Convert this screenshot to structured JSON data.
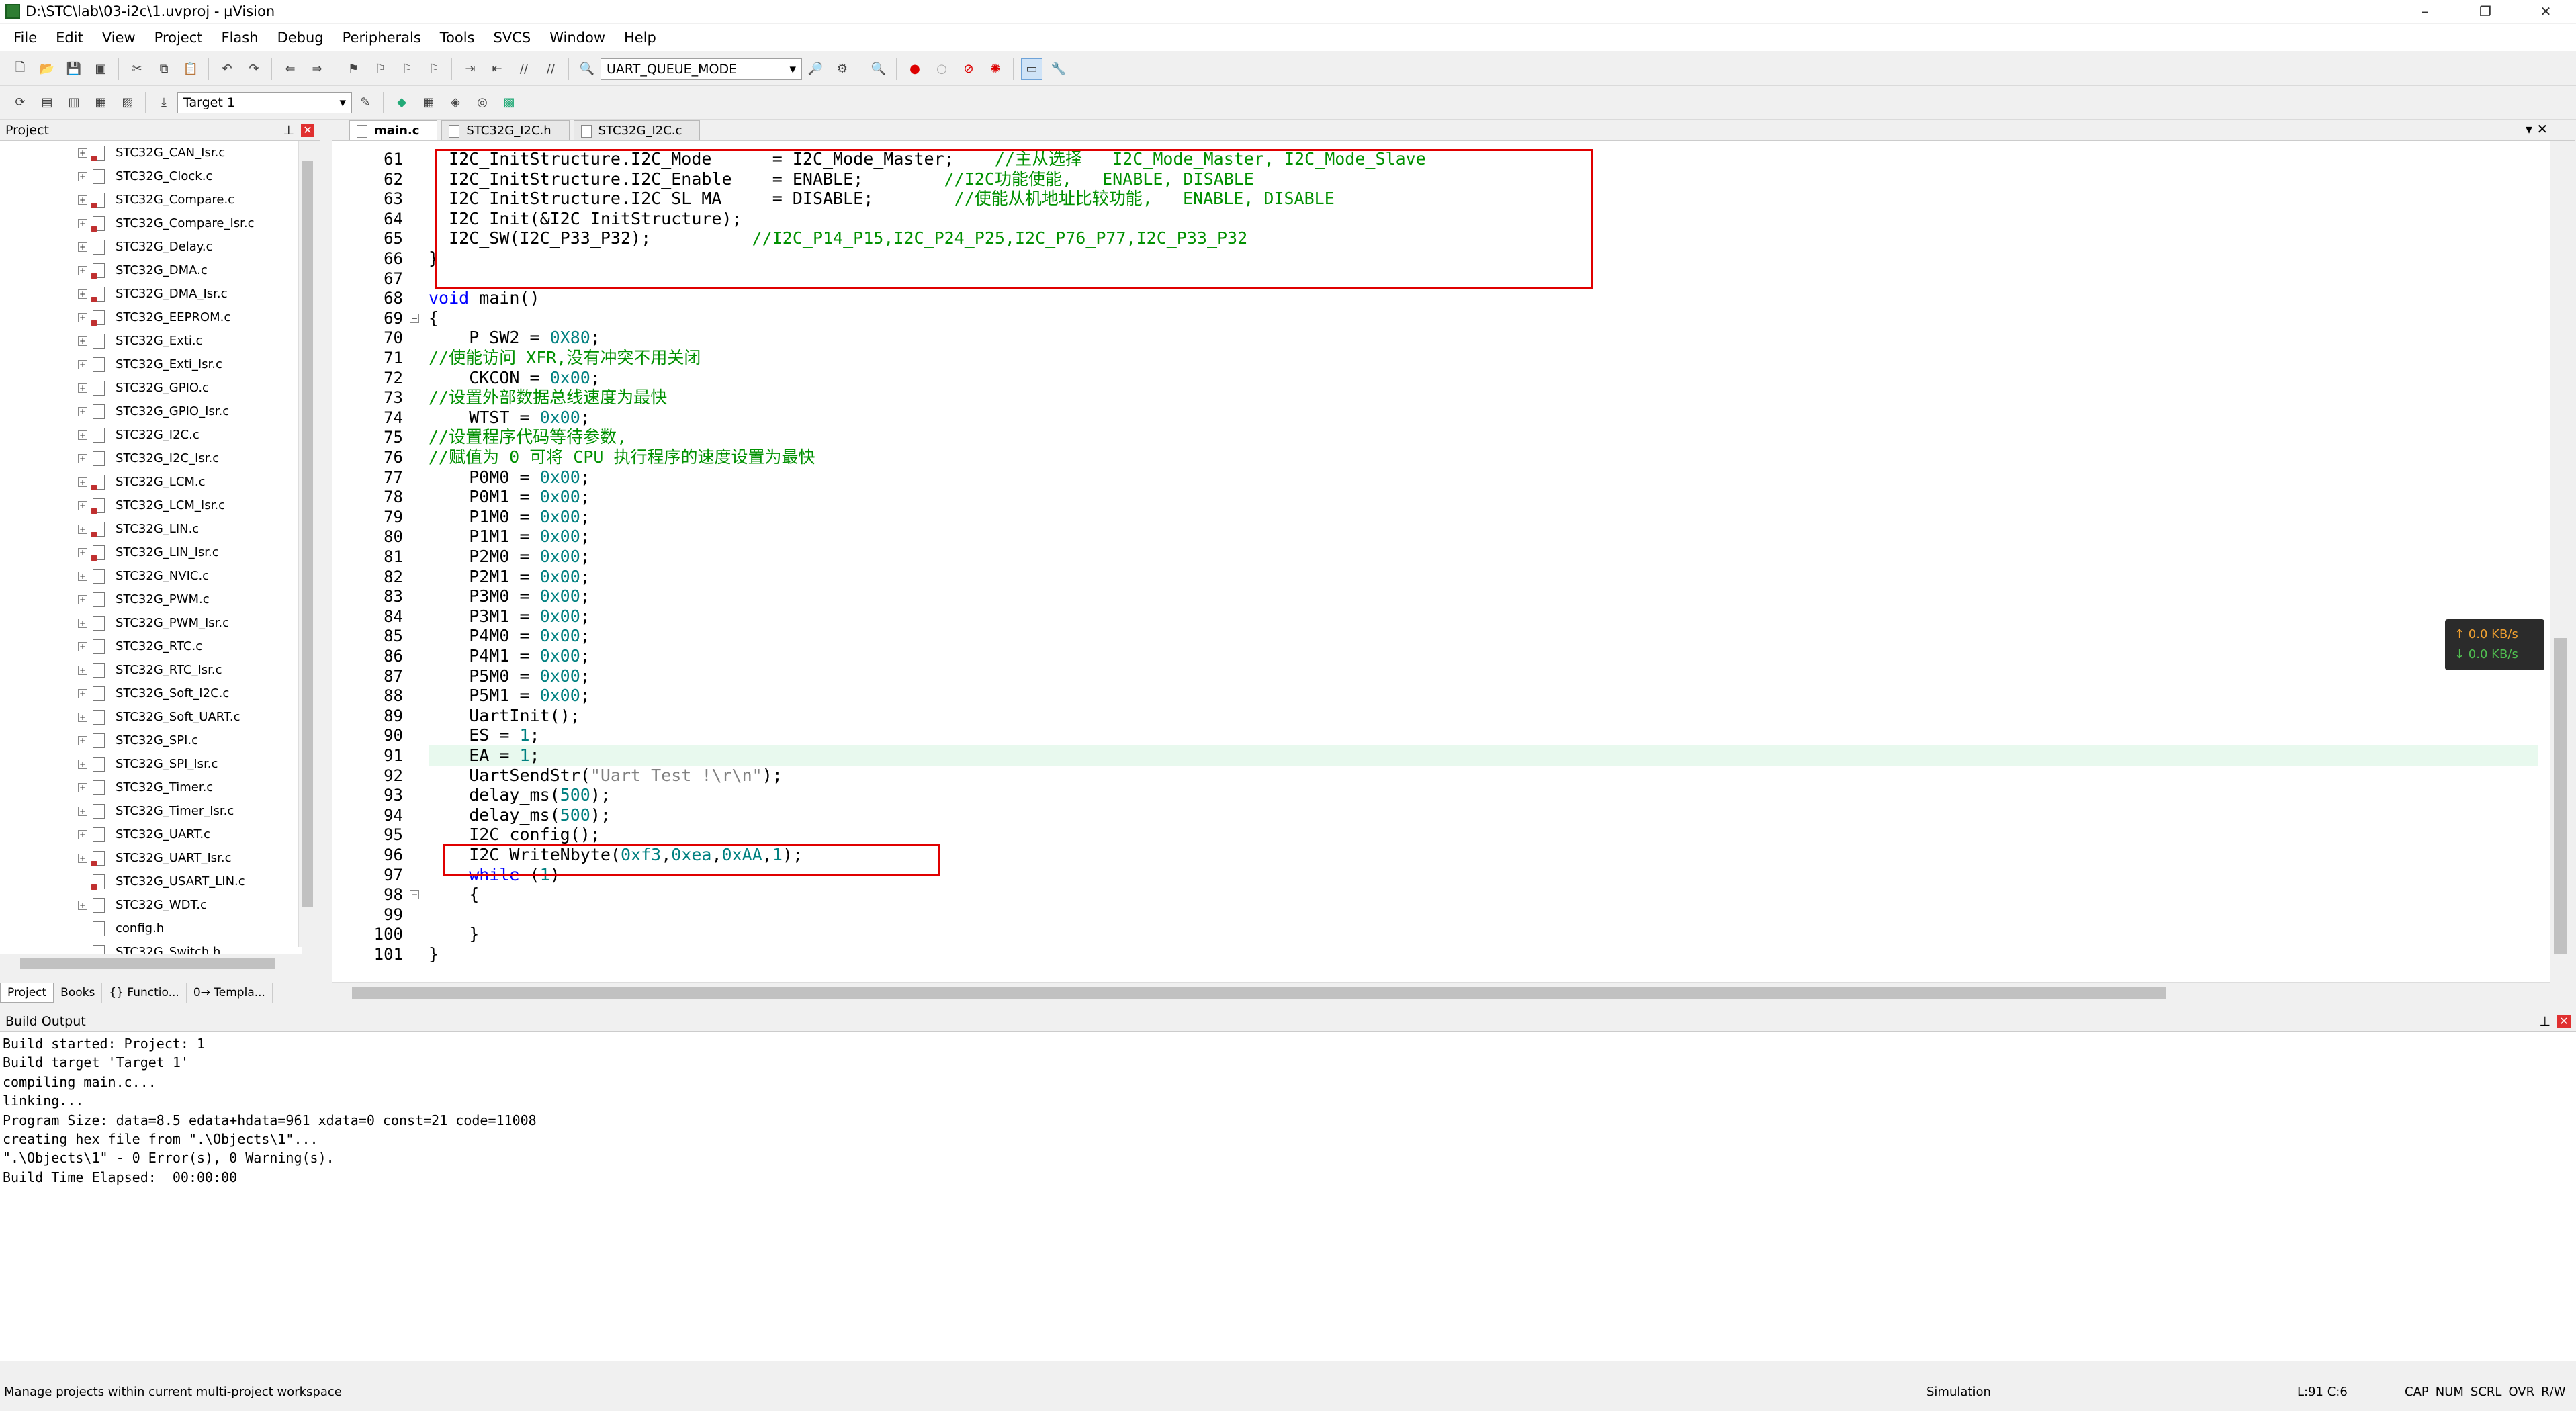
{
  "window": {
    "title": "D:\\STC\\lab\\03-i2c\\1.uvproj - µVision",
    "min": "–",
    "max": "❐",
    "close": "✕"
  },
  "menu": [
    "File",
    "Edit",
    "View",
    "Project",
    "Flash",
    "Debug",
    "Peripherals",
    "Tools",
    "SVCS",
    "Window",
    "Help"
  ],
  "toolbar": {
    "target_combo": "UART_QUEUE_MODE",
    "target_select": "Target 1"
  },
  "project_panel": {
    "title": "Project",
    "files": [
      {
        "name": "STC32G_CAN_Isr.c",
        "lock": true,
        "plus": true
      },
      {
        "name": "STC32G_Clock.c",
        "lock": false,
        "plus": true
      },
      {
        "name": "STC32G_Compare.c",
        "lock": true,
        "plus": true
      },
      {
        "name": "STC32G_Compare_Isr.c",
        "lock": true,
        "plus": true
      },
      {
        "name": "STC32G_Delay.c",
        "lock": false,
        "plus": true
      },
      {
        "name": "STC32G_DMA.c",
        "lock": true,
        "plus": true
      },
      {
        "name": "STC32G_DMA_Isr.c",
        "lock": true,
        "plus": true
      },
      {
        "name": "STC32G_EEPROM.c",
        "lock": true,
        "plus": true
      },
      {
        "name": "STC32G_Exti.c",
        "lock": false,
        "plus": true
      },
      {
        "name": "STC32G_Exti_Isr.c",
        "lock": false,
        "plus": true
      },
      {
        "name": "STC32G_GPIO.c",
        "lock": false,
        "plus": true
      },
      {
        "name": "STC32G_GPIO_Isr.c",
        "lock": false,
        "plus": true
      },
      {
        "name": "STC32G_I2C.c",
        "lock": false,
        "plus": true
      },
      {
        "name": "STC32G_I2C_Isr.c",
        "lock": false,
        "plus": true
      },
      {
        "name": "STC32G_LCM.c",
        "lock": true,
        "plus": true
      },
      {
        "name": "STC32G_LCM_Isr.c",
        "lock": true,
        "plus": true
      },
      {
        "name": "STC32G_LIN.c",
        "lock": true,
        "plus": true
      },
      {
        "name": "STC32G_LIN_Isr.c",
        "lock": true,
        "plus": true
      },
      {
        "name": "STC32G_NVIC.c",
        "lock": false,
        "plus": true
      },
      {
        "name": "STC32G_PWM.c",
        "lock": false,
        "plus": true
      },
      {
        "name": "STC32G_PWM_Isr.c",
        "lock": false,
        "plus": true
      },
      {
        "name": "STC32G_RTC.c",
        "lock": false,
        "plus": true
      },
      {
        "name": "STC32G_RTC_Isr.c",
        "lock": false,
        "plus": true
      },
      {
        "name": "STC32G_Soft_I2C.c",
        "lock": false,
        "plus": true
      },
      {
        "name": "STC32G_Soft_UART.c",
        "lock": false,
        "plus": true
      },
      {
        "name": "STC32G_SPI.c",
        "lock": false,
        "plus": true
      },
      {
        "name": "STC32G_SPI_Isr.c",
        "lock": false,
        "plus": true
      },
      {
        "name": "STC32G_Timer.c",
        "lock": false,
        "plus": true
      },
      {
        "name": "STC32G_Timer_Isr.c",
        "lock": false,
        "plus": true
      },
      {
        "name": "STC32G_UART.c",
        "lock": false,
        "plus": true
      },
      {
        "name": "STC32G_UART_Isr.c",
        "lock": true,
        "plus": true
      },
      {
        "name": "STC32G_USART_LIN.c",
        "lock": true,
        "plus": false
      },
      {
        "name": "STC32G_WDT.c",
        "lock": false,
        "plus": true
      },
      {
        "name": "config.h",
        "lock": false,
        "plus": false
      },
      {
        "name": "STC32G_Switch.h",
        "lock": false,
        "plus": false
      }
    ],
    "bottom_tabs": [
      "Project",
      "Books",
      "{} Functio...",
      "0→ Templa..."
    ]
  },
  "editor": {
    "tabs": [
      "main.c",
      "STC32G_I2C.h",
      "STC32G_I2C.c"
    ],
    "lines": [
      {
        "n": "61",
        "segs": [
          [
            "",
            "  I2C_InitStructure.I2C_Mode      = I2C_Mode_Master;    "
          ],
          [
            "cm",
            "//主从选择   I2C_Mode_Master, I2C_Mode_Slave"
          ]
        ]
      },
      {
        "n": "62",
        "segs": [
          [
            "",
            "  I2C_InitStructure.I2C_Enable    = ENABLE;        "
          ],
          [
            "cm",
            "//I2C功能使能,   ENABLE, DISABLE"
          ]
        ]
      },
      {
        "n": "63",
        "segs": [
          [
            "",
            "  I2C_InitStructure.I2C_SL_MA     = DISABLE;        "
          ],
          [
            "cm",
            "//使能从机地址比较功能,   ENABLE, DISABLE"
          ]
        ]
      },
      {
        "n": "64",
        "segs": [
          [
            "",
            "  I2C_Init(&I2C_InitStructure);"
          ]
        ]
      },
      {
        "n": "65",
        "segs": [
          [
            "",
            "  I2C_SW(I2C_P33_P32);          "
          ],
          [
            "cm",
            "//I2C_P14_P15,I2C_P24_P25,I2C_P76_P77,I2C_P33_P32"
          ]
        ]
      },
      {
        "n": "66",
        "segs": [
          [
            "",
            "}"
          ]
        ]
      },
      {
        "n": "67",
        "segs": []
      },
      {
        "n": "68",
        "segs": [
          [
            "kw",
            "void"
          ],
          [
            "",
            " main()"
          ]
        ]
      },
      {
        "n": "69",
        "segs": [
          [
            "",
            "{"
          ]
        ]
      },
      {
        "n": "70",
        "segs": [
          [
            "",
            "    P_SW2 = "
          ],
          [
            "num",
            "0X80"
          ],
          [
            "",
            ";"
          ]
        ]
      },
      {
        "n": "71",
        "segs": [
          [
            "cm",
            "//使能访问 XFR,没有冲突不用关闭"
          ]
        ]
      },
      {
        "n": "72",
        "segs": [
          [
            "",
            "    CKCON = "
          ],
          [
            "num",
            "0x00"
          ],
          [
            "",
            ";"
          ]
        ]
      },
      {
        "n": "73",
        "segs": [
          [
            "cm",
            "//设置外部数据总线速度为最快"
          ]
        ]
      },
      {
        "n": "74",
        "segs": [
          [
            "",
            "    WTST = "
          ],
          [
            "num",
            "0x00"
          ],
          [
            "",
            ";"
          ]
        ]
      },
      {
        "n": "75",
        "segs": [
          [
            "cm",
            "//设置程序代码等待参数,"
          ]
        ]
      },
      {
        "n": "76",
        "segs": [
          [
            "cm",
            "//赋值为 0 可将 CPU 执行程序的速度设置为最快"
          ]
        ]
      },
      {
        "n": "77",
        "segs": [
          [
            "",
            "    P0M0 = "
          ],
          [
            "num",
            "0x00"
          ],
          [
            "",
            ";"
          ]
        ]
      },
      {
        "n": "78",
        "segs": [
          [
            "",
            "    P0M1 = "
          ],
          [
            "num",
            "0x00"
          ],
          [
            "",
            ";"
          ]
        ]
      },
      {
        "n": "79",
        "segs": [
          [
            "",
            "    P1M0 = "
          ],
          [
            "num",
            "0x00"
          ],
          [
            "",
            ";"
          ]
        ]
      },
      {
        "n": "80",
        "segs": [
          [
            "",
            "    P1M1 = "
          ],
          [
            "num",
            "0x00"
          ],
          [
            "",
            ";"
          ]
        ]
      },
      {
        "n": "81",
        "segs": [
          [
            "",
            "    P2M0 = "
          ],
          [
            "num",
            "0x00"
          ],
          [
            "",
            ";"
          ]
        ]
      },
      {
        "n": "82",
        "segs": [
          [
            "",
            "    P2M1 = "
          ],
          [
            "num",
            "0x00"
          ],
          [
            "",
            ";"
          ]
        ]
      },
      {
        "n": "83",
        "segs": [
          [
            "",
            "    P3M0 = "
          ],
          [
            "num",
            "0x00"
          ],
          [
            "",
            ";"
          ]
        ]
      },
      {
        "n": "84",
        "segs": [
          [
            "",
            "    P3M1 = "
          ],
          [
            "num",
            "0x00"
          ],
          [
            "",
            ";"
          ]
        ]
      },
      {
        "n": "85",
        "segs": [
          [
            "",
            "    P4M0 = "
          ],
          [
            "num",
            "0x00"
          ],
          [
            "",
            ";"
          ]
        ]
      },
      {
        "n": "86",
        "segs": [
          [
            "",
            "    P4M1 = "
          ],
          [
            "num",
            "0x00"
          ],
          [
            "",
            ";"
          ]
        ]
      },
      {
        "n": "87",
        "segs": [
          [
            "",
            "    P5M0 = "
          ],
          [
            "num",
            "0x00"
          ],
          [
            "",
            ";"
          ]
        ]
      },
      {
        "n": "88",
        "segs": [
          [
            "",
            "    P5M1 = "
          ],
          [
            "num",
            "0x00"
          ],
          [
            "",
            ";"
          ]
        ]
      },
      {
        "n": "89",
        "segs": [
          [
            "",
            "    UartInit();"
          ]
        ]
      },
      {
        "n": "90",
        "segs": [
          [
            "",
            "    ES = "
          ],
          [
            "num",
            "1"
          ],
          [
            "",
            ";"
          ]
        ]
      },
      {
        "n": "91",
        "segs": [
          [
            "",
            "    EA = "
          ],
          [
            "num",
            "1"
          ],
          [
            "",
            ";"
          ]
        ]
      },
      {
        "n": "92",
        "segs": [
          [
            "",
            "    UartSendStr("
          ],
          [
            "str",
            "\"Uart Test !\\r\\n\""
          ],
          [
            "",
            ");"
          ]
        ]
      },
      {
        "n": "93",
        "segs": [
          [
            "",
            "    delay_ms("
          ],
          [
            "num",
            "500"
          ],
          [
            "",
            ");"
          ]
        ]
      },
      {
        "n": "94",
        "segs": [
          [
            "",
            "    delay_ms("
          ],
          [
            "num",
            "500"
          ],
          [
            "",
            ");"
          ]
        ]
      },
      {
        "n": "95",
        "segs": [
          [
            "",
            "    I2C_config();"
          ]
        ]
      },
      {
        "n": "96",
        "segs": [
          [
            "",
            "    I2C_WriteNbyte("
          ],
          [
            "num",
            "0xf3"
          ],
          [
            "",
            ","
          ],
          [
            "num",
            "0xea"
          ],
          [
            "",
            ","
          ],
          [
            "num",
            "0xAA"
          ],
          [
            "",
            ","
          ],
          [
            "num",
            "1"
          ],
          [
            "",
            ");"
          ]
        ]
      },
      {
        "n": "97",
        "segs": [
          [
            "kw",
            "    while"
          ],
          [
            "",
            " ("
          ],
          [
            "num",
            "1"
          ],
          [
            "",
            ")"
          ]
        ]
      },
      {
        "n": "98",
        "segs": [
          [
            "",
            "    {"
          ]
        ]
      },
      {
        "n": "99",
        "segs": []
      },
      {
        "n": "100",
        "segs": [
          [
            "",
            "    }"
          ]
        ]
      },
      {
        "n": "101",
        "segs": [
          [
            "",
            "}"
          ]
        ]
      }
    ]
  },
  "net_widget": {
    "up": "↑ 0.0 KB/s",
    "down": "↓ 0.0 KB/s"
  },
  "build_output": {
    "title": "Build Output",
    "text": "Build started: Project: 1\nBuild target 'Target 1'\ncompiling main.c...\nlinking...\nProgram Size: data=8.5 edata+hdata=961 xdata=0 const=21 code=11008\ncreating hex file from \".\\Objects\\1\"...\n\".\\Objects\\1\" - 0 Error(s), 0 Warning(s).\nBuild Time Elapsed:  00:00:00"
  },
  "status": {
    "message": "Manage projects within current multi-project workspace",
    "mode": "Simulation",
    "position": "L:91 C:6",
    "flags": [
      "CAP",
      "NUM",
      "SCRL",
      "OVR",
      "R/W"
    ]
  },
  "colors": {
    "accent_red": "#e00000",
    "keyword": "#0000ff",
    "number": "#008080",
    "comment": "#009000"
  }
}
